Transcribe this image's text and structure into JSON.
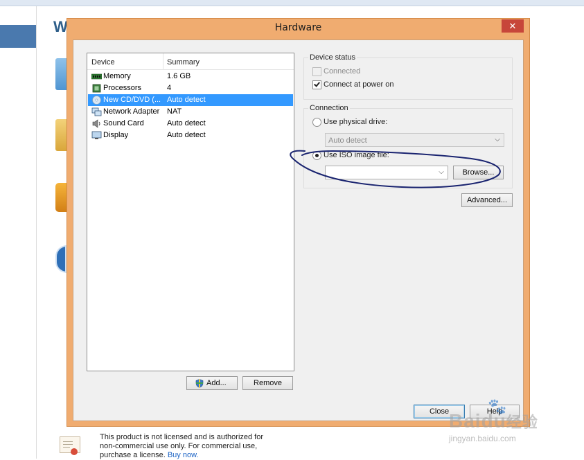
{
  "background": {
    "heading_letter": "W",
    "license": {
      "line1": "This product is not licensed and is authorized for",
      "line2": "non-commercial use only. For commercial use,",
      "line3_prefix": "purchase a license.",
      "link": "Buy now."
    }
  },
  "dialog": {
    "title": "Hardware",
    "close_glyph": "✕",
    "device_list": {
      "headers": [
        "Device",
        "Summary"
      ],
      "rows": [
        {
          "name": "Memory",
          "summary": "1.6 GB",
          "icon": "memory-icon"
        },
        {
          "name": "Processors",
          "summary": "4",
          "icon": "processor-icon"
        },
        {
          "name": "New CD/DVD (...",
          "summary": "Auto detect",
          "icon": "cd-dvd-icon",
          "selected": true
        },
        {
          "name": "Network Adapter",
          "summary": "NAT",
          "icon": "network-adapter-icon"
        },
        {
          "name": "Sound Card",
          "summary": "Auto detect",
          "icon": "sound-card-icon"
        },
        {
          "name": "Display",
          "summary": "Auto detect",
          "icon": "display-icon"
        }
      ]
    },
    "add_label": "Add...",
    "remove_label": "Remove",
    "device_status": {
      "title": "Device status",
      "connected_label": "Connected",
      "connected_checked": false,
      "power_on_label": "Connect at power on",
      "power_on_checked": true
    },
    "connection": {
      "title": "Connection",
      "physical_label": "Use physical drive:",
      "physical_value": "Auto detect",
      "iso_label": "Use ISO image file:",
      "iso_value": "",
      "browse_label": "Browse..."
    },
    "advanced_label": "Advanced...",
    "close_label": "Close",
    "help_label": "Help"
  },
  "watermark": {
    "brand": "Baidu",
    "brand_cn": "经验",
    "sub": "jingyan.baidu.com"
  },
  "colors": {
    "dialog_frame": "#f0ac70",
    "close_button": "#c7463a",
    "selection": "#3399ff",
    "annotation_ink": "#1a2470"
  }
}
